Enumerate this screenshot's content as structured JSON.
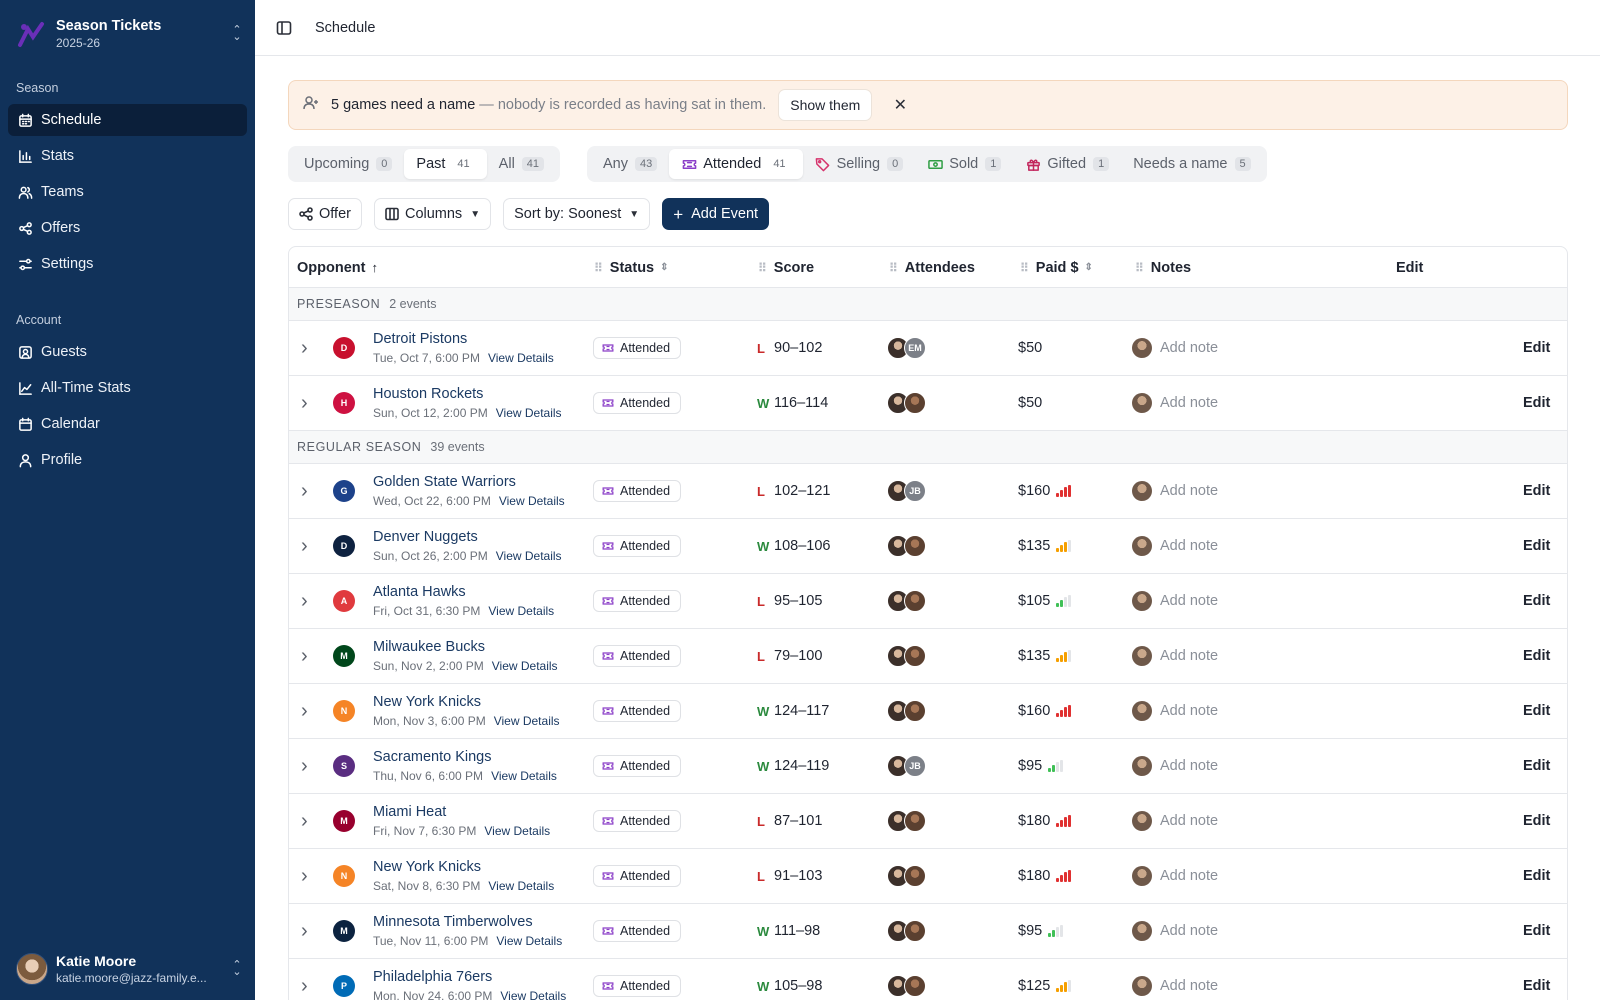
{
  "brand": {
    "title": "Season Tickets",
    "subtitle": "2025-26"
  },
  "nav": {
    "season_label": "Season",
    "season_items": [
      {
        "label": "Schedule",
        "icon": "calendar-grid-icon",
        "active": true
      },
      {
        "label": "Stats",
        "icon": "bar-chart-icon",
        "active": false
      },
      {
        "label": "Teams",
        "icon": "users-icon",
        "active": false
      },
      {
        "label": "Offers",
        "icon": "share-icon",
        "active": false
      },
      {
        "label": "Settings",
        "icon": "sliders-icon",
        "active": false
      }
    ],
    "account_label": "Account",
    "account_items": [
      {
        "label": "Guests",
        "icon": "contact-icon"
      },
      {
        "label": "All-Time Stats",
        "icon": "line-chart-icon"
      },
      {
        "label": "Calendar",
        "icon": "calendar-icon"
      },
      {
        "label": "Profile",
        "icon": "user-icon"
      }
    ]
  },
  "user": {
    "name": "Katie Moore",
    "email": "katie.moore@jazz-family.e..."
  },
  "topbar": {
    "breadcrumb": "Schedule"
  },
  "banner": {
    "strong": "5 games need a name",
    "muted": "— nobody is recorded as having sat in them.",
    "button": "Show them"
  },
  "time_tabs": [
    {
      "label": "Upcoming",
      "count": "0",
      "active": false
    },
    {
      "label": "Past",
      "count": "41",
      "active": true
    },
    {
      "label": "All",
      "count": "41",
      "active": false
    }
  ],
  "status_tabs": [
    {
      "label": "Any",
      "count": "43",
      "active": false,
      "icon": ""
    },
    {
      "label": "Attended",
      "count": "41",
      "active": true,
      "icon": "ticket-icon"
    },
    {
      "label": "Selling",
      "count": "0",
      "active": false,
      "icon": "tag-icon"
    },
    {
      "label": "Sold",
      "count": "1",
      "active": false,
      "icon": "banknote-icon"
    },
    {
      "label": "Gifted",
      "count": "1",
      "active": false,
      "icon": "gift-icon"
    },
    {
      "label": "Needs a name",
      "count": "5",
      "active": false,
      "icon": ""
    }
  ],
  "toolbar": {
    "offer": "Offer",
    "columns": "Columns",
    "sort": "Sort by: Soonest",
    "add_event": "Add Event"
  },
  "columns": {
    "opponent": "Opponent",
    "status": "Status",
    "score": "Score",
    "attendees": "Attendees",
    "paid": "Paid $",
    "notes": "Notes",
    "edit": "Edit"
  },
  "groups": [
    {
      "label": "PRESEASON",
      "count": "2 events",
      "rows": [
        {
          "team": "Detroit Pistons",
          "date": "Tue, Oct 7, 6:00 PM",
          "status": "Attended",
          "result": "L",
          "score": "90–102",
          "attendees": [
            "photo1",
            "EM"
          ],
          "paid": "$50",
          "bars": 0,
          "bar_color": "",
          "logo": "DET",
          "logo_color": "#c8102e"
        },
        {
          "team": "Houston Rockets",
          "date": "Sun, Oct 12, 2:00 PM",
          "status": "Attended",
          "result": "W",
          "score": "116–114",
          "attendees": [
            "photo1",
            "photo2"
          ],
          "paid": "$50",
          "bars": 0,
          "bar_color": "",
          "logo": "HOU",
          "logo_color": "#ce1141"
        }
      ]
    },
    {
      "label": "REGULAR SEASON",
      "count": "39 events",
      "rows": [
        {
          "team": "Golden State Warriors",
          "date": "Wed, Oct 22, 6:00 PM",
          "status": "Attended",
          "result": "L",
          "score": "102–121",
          "attendees": [
            "photo1",
            "JB"
          ],
          "paid": "$160",
          "bars": 4,
          "bar_color": "#e03131",
          "logo": "GSW",
          "logo_color": "#1d428a"
        },
        {
          "team": "Denver Nuggets",
          "date": "Sun, Oct 26, 2:00 PM",
          "status": "Attended",
          "result": "W",
          "score": "108–106",
          "attendees": [
            "photo1",
            "photo2"
          ],
          "paid": "$135",
          "bars": 3,
          "bar_color": "#f59f00",
          "logo": "DEN",
          "logo_color": "#0e2240"
        },
        {
          "team": "Atlanta Hawks",
          "date": "Fri, Oct 31, 6:30 PM",
          "status": "Attended",
          "result": "L",
          "score": "95–105",
          "attendees": [
            "photo1",
            "photo2"
          ],
          "paid": "$105",
          "bars": 2,
          "bar_color": "#40c057",
          "logo": "ATL",
          "logo_color": "#e03a3e"
        },
        {
          "team": "Milwaukee Bucks",
          "date": "Sun, Nov 2, 2:00 PM",
          "status": "Attended",
          "result": "L",
          "score": "79–100",
          "attendees": [
            "photo1",
            "photo2"
          ],
          "paid": "$135",
          "bars": 3,
          "bar_color": "#f59f00",
          "logo": "MIL",
          "logo_color": "#00471b"
        },
        {
          "team": "New York Knicks",
          "date": "Mon, Nov 3, 6:00 PM",
          "status": "Attended",
          "result": "W",
          "score": "124–117",
          "attendees": [
            "photo1",
            "photo2"
          ],
          "paid": "$160",
          "bars": 4,
          "bar_color": "#e03131",
          "logo": "NYK",
          "logo_color": "#f58426"
        },
        {
          "team": "Sacramento Kings",
          "date": "Thu, Nov 6, 6:00 PM",
          "status": "Attended",
          "result": "W",
          "score": "124–119",
          "attendees": [
            "photo1",
            "JB"
          ],
          "paid": "$95",
          "bars": 2,
          "bar_color": "#40c057",
          "logo": "SAC",
          "logo_color": "#5a2d81"
        },
        {
          "team": "Miami Heat",
          "date": "Fri, Nov 7, 6:30 PM",
          "status": "Attended",
          "result": "L",
          "score": "87–101",
          "attendees": [
            "photo1",
            "photo2"
          ],
          "paid": "$180",
          "bars": 4,
          "bar_color": "#e03131",
          "logo": "MIA",
          "logo_color": "#98002e"
        },
        {
          "team": "New York Knicks",
          "date": "Sat, Nov 8, 6:30 PM",
          "status": "Attended",
          "result": "L",
          "score": "91–103",
          "attendees": [
            "photo1",
            "photo2"
          ],
          "paid": "$180",
          "bars": 4,
          "bar_color": "#e03131",
          "logo": "NYK",
          "logo_color": "#f58426"
        },
        {
          "team": "Minnesota Timberwolves",
          "date": "Tue, Nov 11, 6:00 PM",
          "status": "Attended",
          "result": "W",
          "score": "111–98",
          "attendees": [
            "photo1",
            "photo2"
          ],
          "paid": "$95",
          "bars": 2,
          "bar_color": "#40c057",
          "logo": "MIN",
          "logo_color": "#0c2340"
        },
        {
          "team": "Philadelphia 76ers",
          "date": "Mon, Nov 24, 6:00 PM",
          "status": "Attended",
          "result": "W",
          "score": "105–98",
          "attendees": [
            "photo1",
            "photo2"
          ],
          "paid": "$125",
          "bars": 3,
          "bar_color": "#f59f00",
          "logo": "PHI",
          "logo_color": "#006bb6"
        }
      ]
    }
  ],
  "row_labels": {
    "view_details": "View Details",
    "add_note": "Add note",
    "edit": "Edit"
  }
}
